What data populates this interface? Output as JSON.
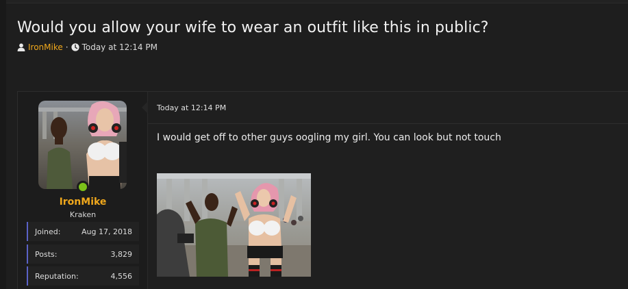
{
  "thread": {
    "title": "Would you allow your wife to wear an outfit like this in public?",
    "author": "IronMike",
    "separator": "·",
    "timestamp": "Today at 12:14 PM"
  },
  "post": {
    "user": {
      "name": "IronMike",
      "title": "Kraken",
      "online_status_color": "#7cc21a",
      "stats": [
        {
          "label": "Joined:",
          "value": "Aug 17, 2018"
        },
        {
          "label": "Posts:",
          "value": "3,829"
        },
        {
          "label": "Reputation:",
          "value": "4,556"
        }
      ]
    },
    "timestamp": "Today at 12:14 PM",
    "message": "I would get off to other guys oogling my girl. You can look but not touch",
    "attached_image": "photo"
  },
  "colors": {
    "accent": "#f0a81c",
    "stat_border": "#5a62c8",
    "background": "#1e1e1e"
  },
  "icons": {
    "author": "user-icon",
    "time": "clock-icon"
  }
}
